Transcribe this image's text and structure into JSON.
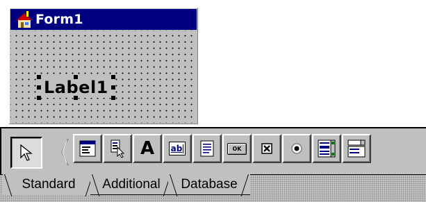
{
  "form": {
    "title": "Form1",
    "label_caption": "Label1"
  },
  "palette": {
    "tools": [
      {
        "name": "pointer",
        "icon": "pointer-arrow-icon"
      },
      {
        "name": "mainmenu",
        "icon": "mainmenu-icon"
      },
      {
        "name": "popupmenu",
        "icon": "popupmenu-icon"
      },
      {
        "name": "label",
        "icon": "label-a-icon"
      },
      {
        "name": "edit",
        "icon": "edit-ab-icon"
      },
      {
        "name": "memo",
        "icon": "memo-icon"
      },
      {
        "name": "button",
        "icon": "button-ok-icon",
        "glyph": "OK"
      },
      {
        "name": "checkbox",
        "icon": "checkbox-icon"
      },
      {
        "name": "radiobutton",
        "icon": "radiobutton-icon"
      },
      {
        "name": "listbox",
        "icon": "listbox-icon"
      },
      {
        "name": "combobox",
        "icon": "combobox-icon"
      }
    ],
    "tool_glyphs": {
      "label": "A",
      "edit": "ab",
      "ok": "OK"
    },
    "tabs": [
      "Standard",
      "Additional",
      "Database"
    ],
    "active_tab": "Standard"
  },
  "colors": {
    "titlebar": "#000080",
    "face": "#c0c0c0"
  }
}
